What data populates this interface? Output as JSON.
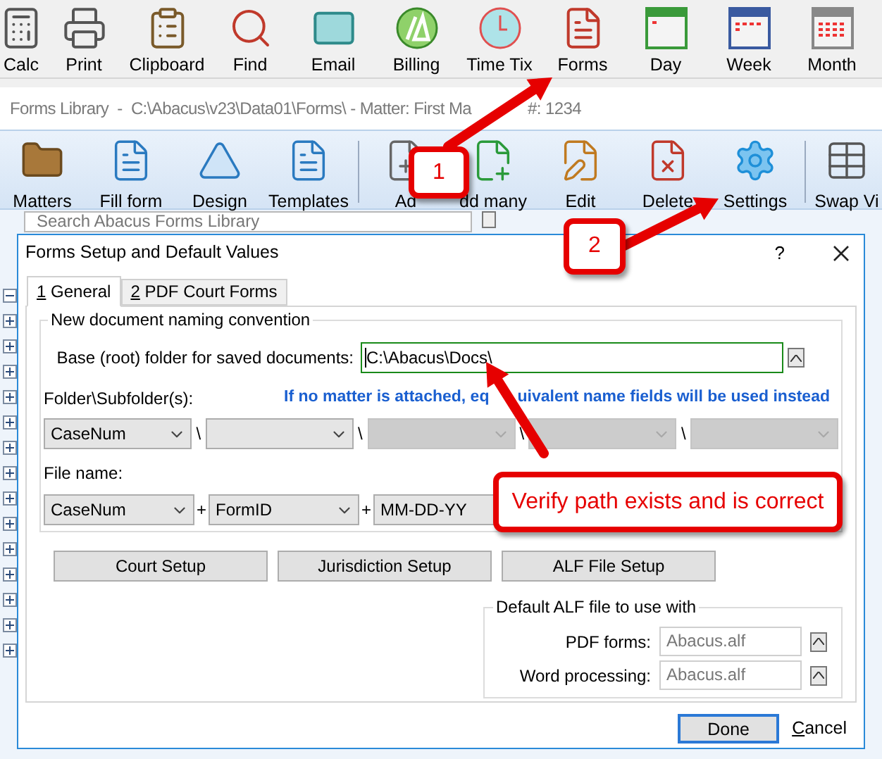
{
  "toolbar": [
    {
      "label": "Calc",
      "kind": "calc"
    },
    {
      "label": "Print",
      "kind": "print"
    },
    {
      "label": "Clipboard",
      "kind": "clipboard"
    },
    {
      "label": "Find",
      "kind": "find"
    },
    {
      "label": "Email",
      "kind": "email"
    },
    {
      "label": "Billing",
      "kind": "billing"
    },
    {
      "label": "Time Tix",
      "kind": "clock"
    },
    {
      "label": "Forms",
      "kind": "forms"
    },
    {
      "label": "Day",
      "kind": "day"
    },
    {
      "label": "Week",
      "kind": "week"
    },
    {
      "label": "Month",
      "kind": "month"
    }
  ],
  "library_window": {
    "title": "Forms Library  -  C:\\Abacus\\v23\\Data01\\Forms\\ - Matter: First Ma",
    "matter_number": "#: 1234",
    "tools": [
      {
        "label": "Matters",
        "kind": "folder"
      },
      {
        "label": "Fill form",
        "kind": "fill"
      },
      {
        "label": "Design",
        "kind": "design"
      },
      {
        "label": "Templates",
        "kind": "templates"
      },
      {
        "label": "Ad",
        "kind": "add"
      },
      {
        "label": "dd many",
        "kind": "addmany"
      },
      {
        "label": "Edit",
        "kind": "edit"
      },
      {
        "label": "Delete",
        "kind": "delete"
      },
      {
        "label": "Settings",
        "kind": "settings"
      },
      {
        "label": "Swap Vi",
        "kind": "swap"
      }
    ],
    "search": {
      "placeholder": "Search Abacus Forms Library"
    }
  },
  "dialog": {
    "title": "Forms Setup and Default Values",
    "help": "?",
    "tabs": [
      {
        "label": "1 General",
        "selected": true
      },
      {
        "label": "2 PDF Court Forms",
        "selected": false
      }
    ],
    "naming": {
      "legend": "New document naming convention",
      "base_label": "Base (root) folder for saved documents:",
      "base_value": "C:\\Abacus\\Docs\\",
      "folder_label": "Folder\\Subfolder(s):",
      "note": [
        "If no matter is attached, eq",
        "uivalent name fields will be used instead"
      ],
      "folders": [
        {
          "value": "CaseNum",
          "disabled": false
        },
        {
          "separator": "\\",
          "disabled": false
        },
        {
          "separator": "\\",
          "disabled": true
        },
        {
          "separator": "\\",
          "disabled": true
        },
        {
          "separator": "\\",
          "disabled": true
        }
      ],
      "file_label": "File name:",
      "file_parts": [
        {
          "value": "CaseNum"
        },
        {
          "separator": "+",
          "value": "FormID"
        },
        {
          "separator": "+",
          "value": "MM-DD-YY"
        }
      ]
    },
    "buttons": [
      "Court Setup",
      "Jurisdiction Setup",
      "ALF File Setup"
    ],
    "alf": {
      "legend": "Default ALF file to use with",
      "rows": [
        {
          "label": "PDF forms:",
          "value": "Abacus.alf"
        },
        {
          "label": "Word processing:",
          "value": "Abacus.alf"
        }
      ]
    },
    "done": "Done",
    "cancel": "Cancel"
  },
  "callouts": [
    {
      "label": "1"
    },
    {
      "label": "2"
    },
    {
      "label": "Verify path exists and is correct"
    }
  ]
}
